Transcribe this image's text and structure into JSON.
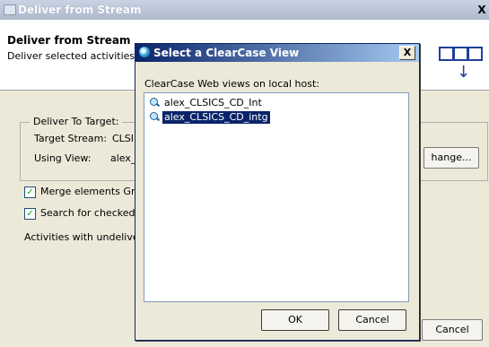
{
  "back_dialog": {
    "title": "Deliver from Stream",
    "header_title": "Deliver from Stream",
    "header_subtitle": "Deliver selected activities",
    "group_label": "Deliver To Target:",
    "target_stream_label": "Target Stream:",
    "target_stream_value": "CLSI(",
    "using_view_label": "Using View:",
    "using_view_value": "alex_",
    "change_button": "hange...",
    "merge_checkbox_label": "Merge elements Grap",
    "merge_checked": true,
    "search_checkbox_label": "Search for checked o",
    "search_checked": true,
    "activities_label": "Activities with undelivered",
    "cancel_button": "Cancel",
    "close_glyph": "X"
  },
  "front_dialog": {
    "title": "Select a ClearCase View",
    "close_glyph": "X",
    "caption": "ClearCase Web views on local host:",
    "views": [
      {
        "name": "alex_CLSICS_CD_Int",
        "selected": false
      },
      {
        "name": "alex_CLSICS_CD_intg",
        "selected": true
      }
    ],
    "ok_button": "OK",
    "cancel_button": "Cancel"
  },
  "colors": {
    "title_active": "#0a246a",
    "selection": "#0a246a",
    "dialog_face": "#ece9d8",
    "accent_icon": "#1f3f99"
  }
}
